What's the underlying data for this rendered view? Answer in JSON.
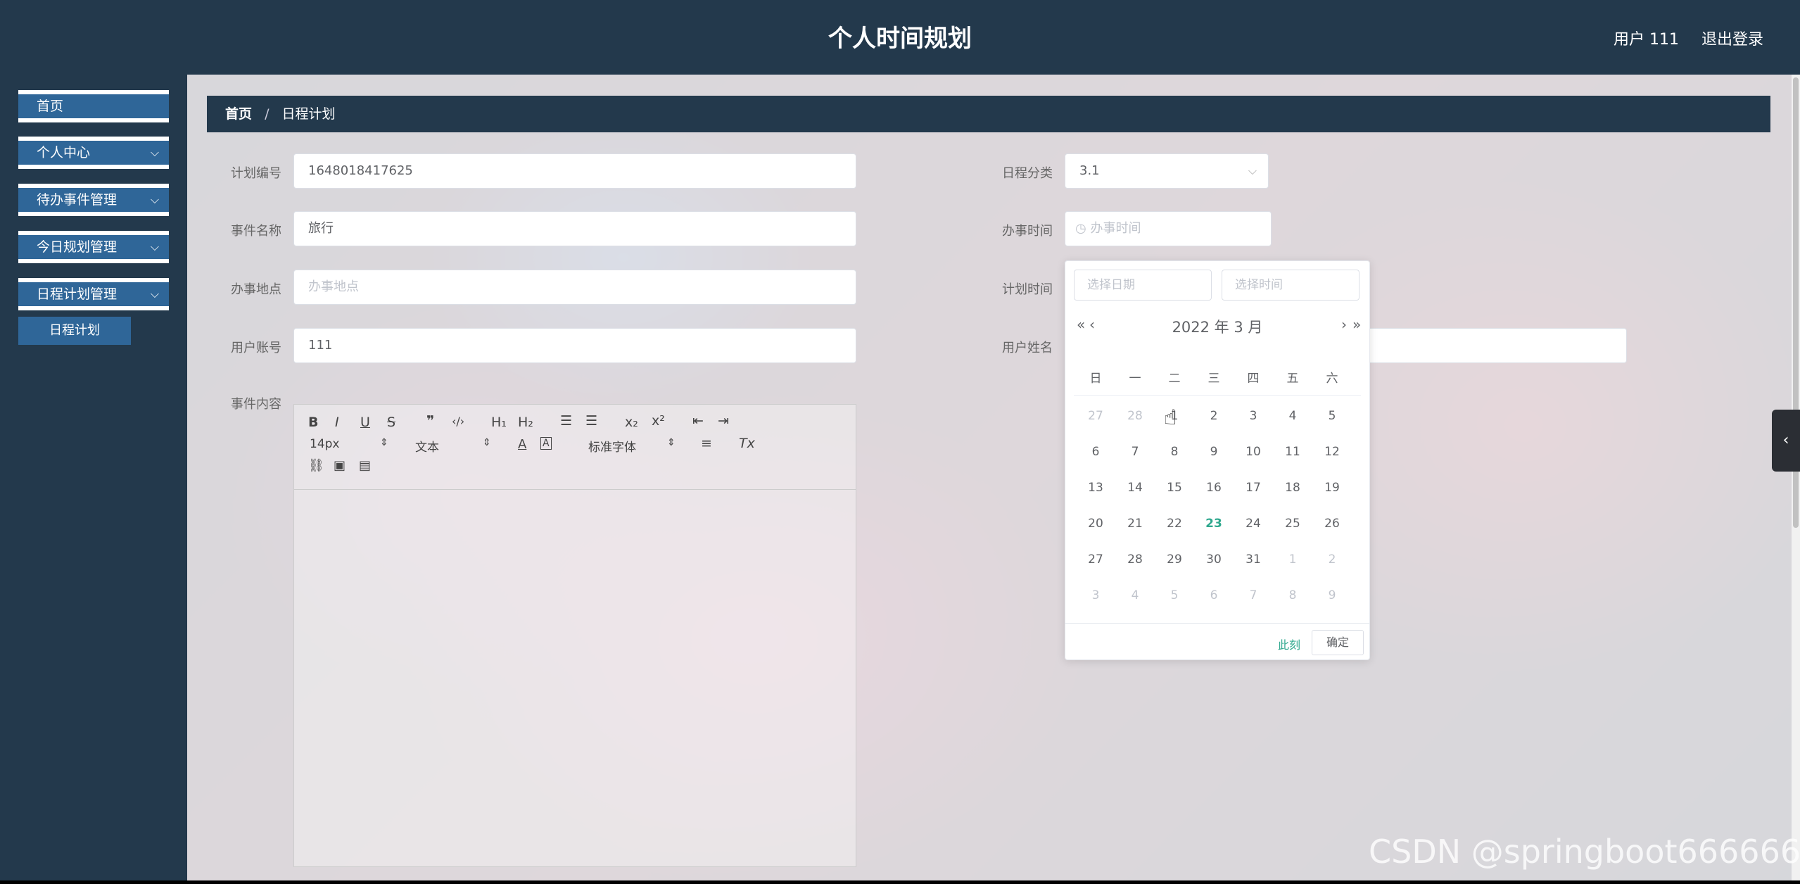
{
  "header": {
    "title": "个人时间规划",
    "user_label": "用户 111",
    "logout": "退出登录"
  },
  "sidebar": {
    "items": [
      {
        "label": "首页",
        "has_chevron": false
      },
      {
        "label": "个人中心",
        "has_chevron": true
      },
      {
        "label": "待办事件管理",
        "has_chevron": true
      },
      {
        "label": "今日规划管理",
        "has_chevron": true
      },
      {
        "label": "日程计划管理",
        "has_chevron": true
      }
    ],
    "subitem": "日程计划",
    "chevron_icon": "chevron-down-icon"
  },
  "breadcrumb": {
    "home": "首页",
    "separator": "/",
    "current": "日程计划"
  },
  "form": {
    "plan_no_label": "计划编号",
    "plan_no_value": "1648018417625",
    "event_name_label": "事件名称",
    "event_name_value": "旅行",
    "location_label": "办事地点",
    "location_placeholder": "办事地点",
    "account_label": "用户账号",
    "account_value": "111",
    "category_label": "日程分类",
    "category_value": "3.1",
    "time_label": "办事时间",
    "time_placeholder": "办事时间",
    "plan_time_label": "计划时间",
    "username_label": "用户姓名",
    "content_label": "事件内容"
  },
  "editor": {
    "bold": "B",
    "italic": "I",
    "underline": "U",
    "strike": "S",
    "quote": "❞",
    "code": "‹/›",
    "h1": "H₁",
    "h2": "H₂",
    "sub": "x₂",
    "sup": "x²",
    "size_value": "14px",
    "header_value": "文本",
    "font_value": "标准字体",
    "clear": "Tx"
  },
  "calendar": {
    "date_placeholder": "选择日期",
    "time_placeholder": "选择时间",
    "year_label": "2022 年",
    "month_label": "3 月",
    "prev_year": "«",
    "prev_month": "‹",
    "next_month": "›",
    "next_year": "»",
    "weekdays": [
      "日",
      "一",
      "二",
      "三",
      "四",
      "五",
      "六"
    ],
    "weeks": [
      [
        "27",
        "28",
        "1",
        "2",
        "3",
        "4",
        "5"
      ],
      [
        "6",
        "7",
        "8",
        "9",
        "10",
        "11",
        "12"
      ],
      [
        "13",
        "14",
        "15",
        "16",
        "17",
        "18",
        "19"
      ],
      [
        "20",
        "21",
        "22",
        "23",
        "24",
        "25",
        "26"
      ],
      [
        "27",
        "28",
        "29",
        "30",
        "31",
        "1",
        "2"
      ],
      [
        "3",
        "4",
        "5",
        "6",
        "7",
        "8",
        "9"
      ]
    ],
    "today": "23",
    "now_label": "此刻",
    "confirm_label": "确定",
    "today_color": "#2fa88e"
  },
  "watermark": "CSDN @springboot666666",
  "colors": {
    "header_bg": "#23394c",
    "menu_bg": "#2f6698",
    "accent": "#2fa88e"
  }
}
